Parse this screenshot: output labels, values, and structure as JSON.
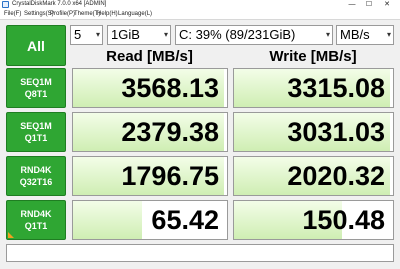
{
  "window": {
    "title": "CrystalDiskMark 7.0.0 x64 [ADMIN]",
    "controls": {
      "minimize": "—",
      "maximize": "☐",
      "close": "✕"
    }
  },
  "menu": [
    "File(F)",
    "Settings(S)",
    "Profile(P)",
    "Theme(T)",
    "Help(H)",
    "Language(L)"
  ],
  "toolbar": {
    "all_label": "All",
    "count": "5",
    "size": "1GiB",
    "drive": "C: 39% (89/231GiB)",
    "unit": "MB/s",
    "dropdown_glyph": "▾"
  },
  "headers": {
    "read": "Read [MB/s]",
    "write": "Write [MB/s]"
  },
  "rows": [
    {
      "label_line1": "SEQ1M",
      "label_line2": "Q8T1",
      "read": "3568.13",
      "write": "3315.08",
      "read_level": 0.98,
      "write_level": 0.98
    },
    {
      "label_line1": "SEQ1M",
      "label_line2": "Q1T1",
      "read": "2379.38",
      "write": "3031.03",
      "read_level": 0.98,
      "write_level": 0.98
    },
    {
      "label_line1": "RND4K",
      "label_line2": "Q32T16",
      "read": "1796.75",
      "write": "2020.32",
      "read_level": 0.98,
      "write_level": 0.98
    },
    {
      "label_line1": "RND4K",
      "label_line2": "Q1T1",
      "read": "65.42",
      "write": "150.48",
      "read_level": 0.45,
      "write_level": 0.68
    }
  ],
  "colors": {
    "accent_green": "#2fa633",
    "bar_light": "#f3fde8",
    "bar_dark": "#cfeeb3"
  },
  "status": ""
}
